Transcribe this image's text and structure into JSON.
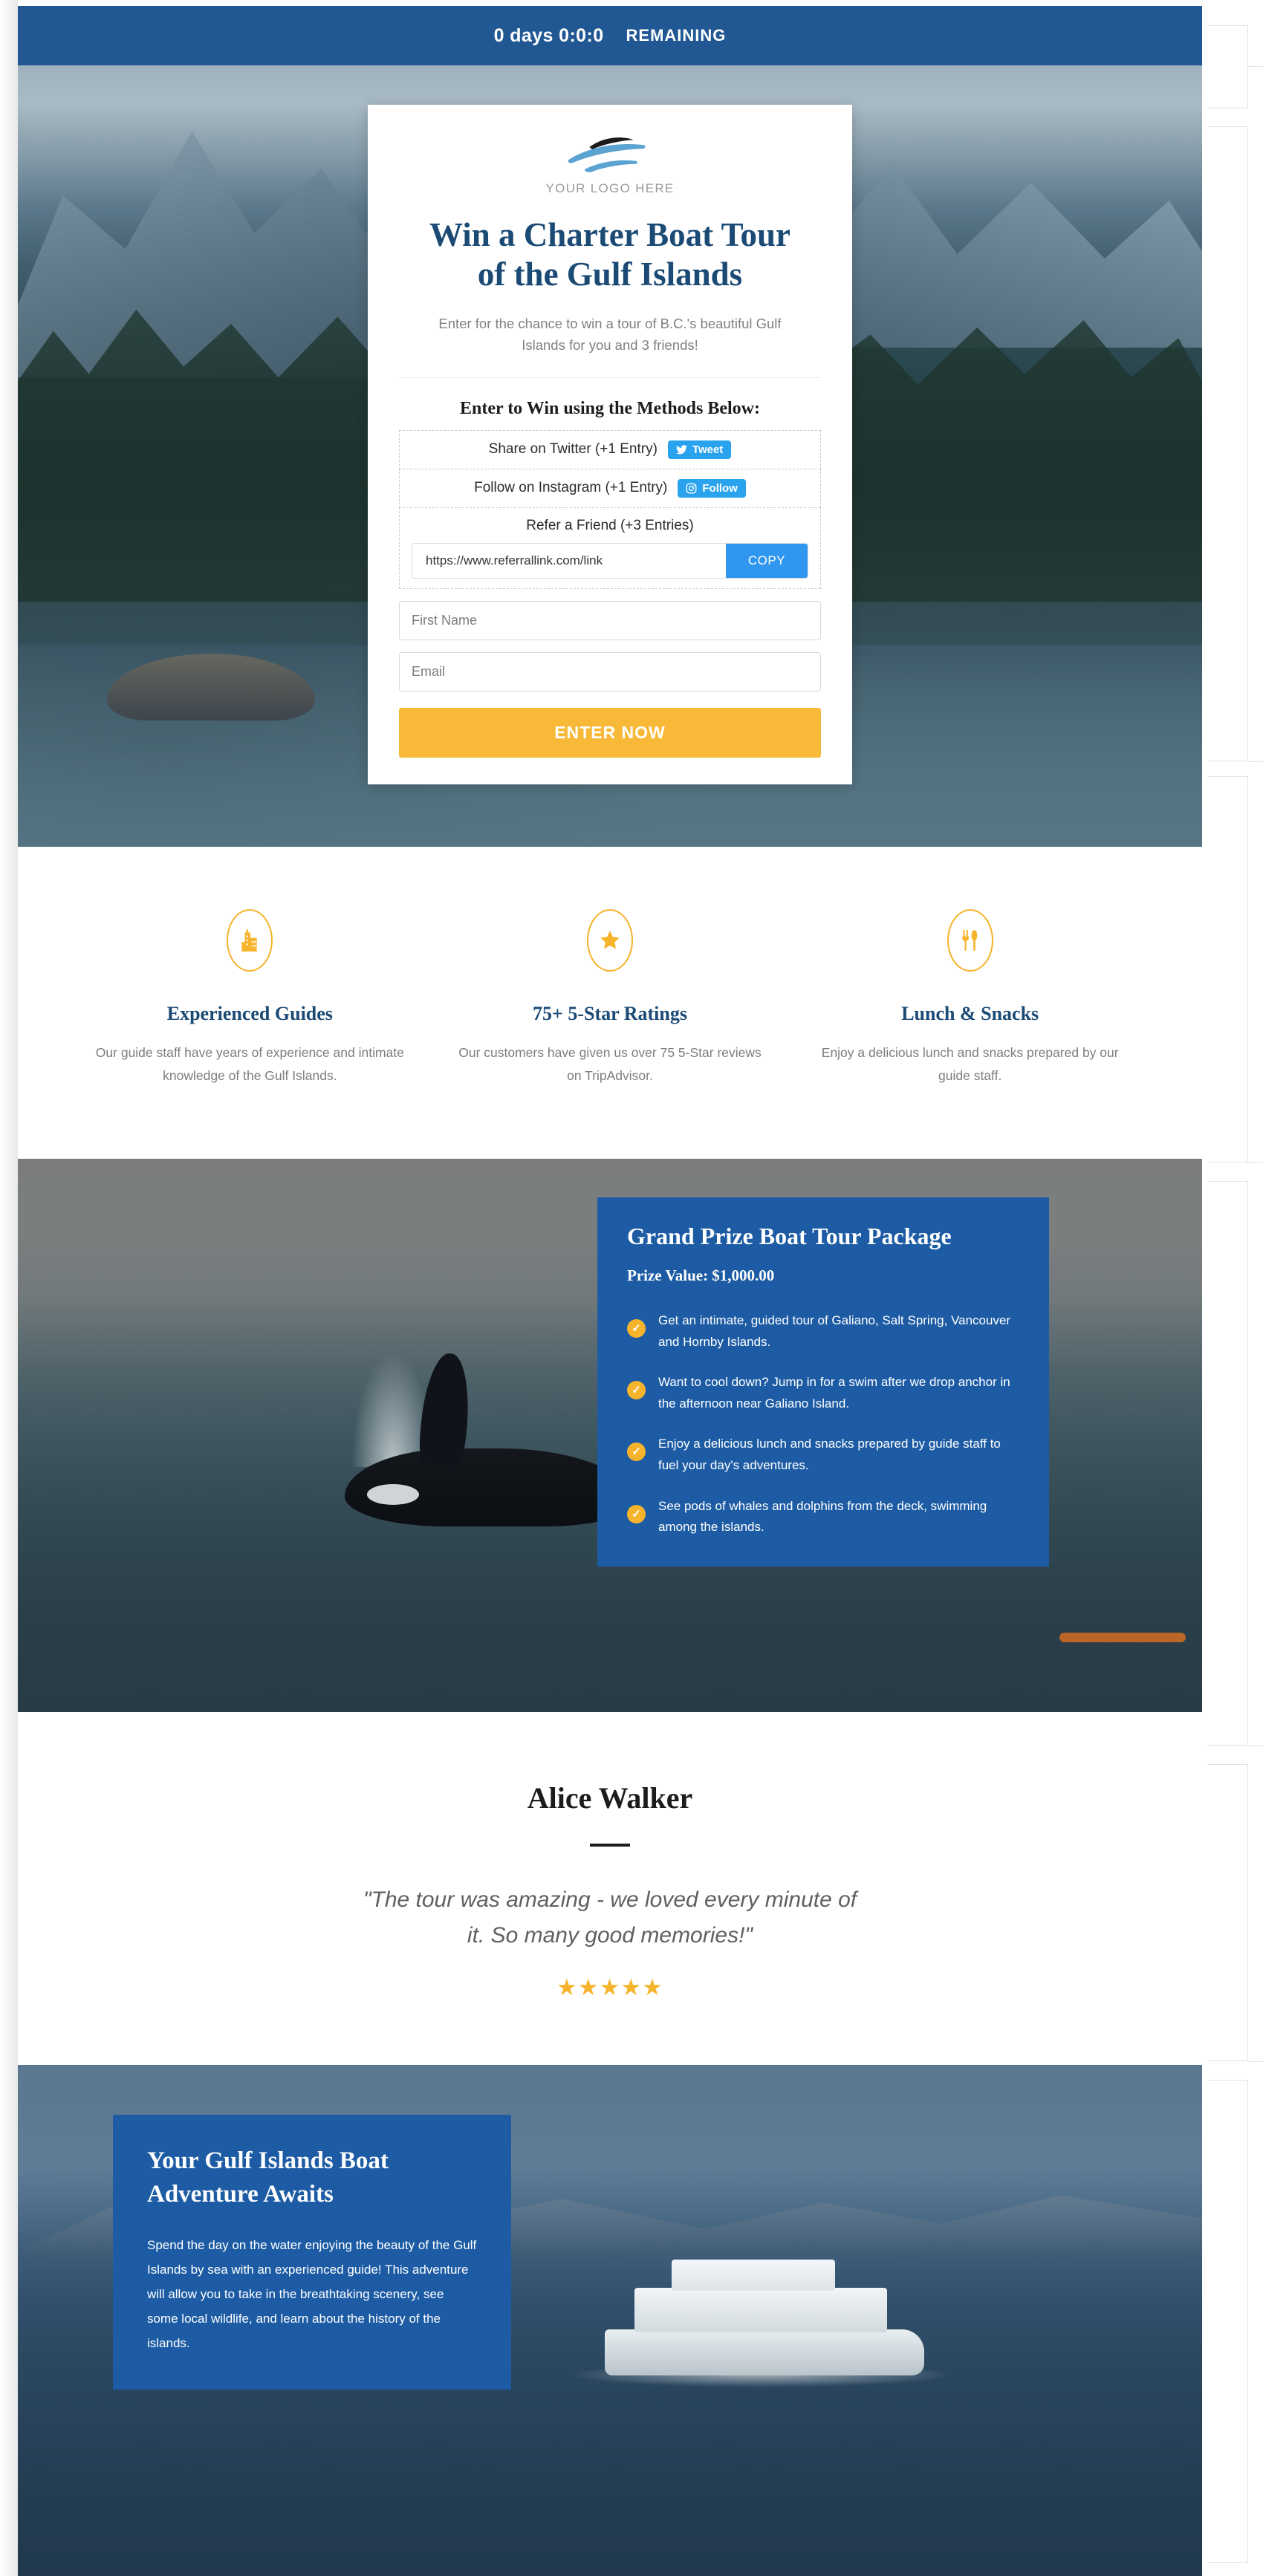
{
  "countdown": {
    "time": "0 days 0:0:0",
    "label": "REMAINING"
  },
  "card": {
    "logo_text": "YOUR LOGO HERE",
    "title_line1": "Win a Charter Boat Tour",
    "title_line2": "of the Gulf Islands",
    "subtitle": "Enter for the chance to win a tour of B.C.'s beautiful Gulf Islands for you and 3 friends!",
    "methods_title": "Enter to Win using the Methods Below:",
    "methods": [
      {
        "label": "Share on Twitter (+1 Entry)",
        "button": "Tweet",
        "icon": "twitter-bird-icon"
      },
      {
        "label": "Follow on Instagram (+1 Entry)",
        "button": "Follow",
        "icon": "instagram-camera-icon"
      }
    ],
    "refer": {
      "label": "Refer a Friend (+3 Entries)",
      "link_value": "https://www.referrallink.com/link",
      "copy_label": "COPY"
    },
    "first_name_placeholder": "First Name",
    "email_placeholder": "Email",
    "submit_label": "ENTER NOW"
  },
  "features": [
    {
      "icon": "building-icon",
      "title": "Experienced Guides",
      "desc": "Our guide staff have years of experience and intimate knowledge of the Gulf Islands."
    },
    {
      "icon": "star-icon",
      "title": "75+ 5-Star Ratings",
      "desc": "Our customers have given us over 75 5-Star reviews on TripAdvisor."
    },
    {
      "icon": "fork-knife-icon",
      "title": "Lunch & Snacks",
      "desc": "Enjoy a delicious lunch and snacks prepared by our guide staff."
    }
  ],
  "prize": {
    "title": "Grand Prize Boat Tour Package",
    "value": "Prize Value: $1,000.00",
    "items": [
      "Get an intimate, guided tour of Galiano, Salt Spring, Vancouver and Hornby Islands.",
      "Want to cool down? Jump in for a swim after we drop anchor in the afternoon near Galiano Island.",
      "Enjoy a delicious lunch and snacks prepared by guide staff to fuel your day's adventures.",
      "See pods of whales and dolphins from the deck, swimming among the islands."
    ]
  },
  "testimonial": {
    "name": "Alice Walker",
    "quote": "\"The tour was amazing - we loved every minute of it. So many good memories!\"",
    "stars": "★★★★★"
  },
  "cta": {
    "title_line1": "Your Gulf Islands Boat",
    "title_line2": "Adventure Awaits",
    "text": "Spend the day on the water enjoying the beauty of the Gulf Islands by sea with an experienced guide! This adventure will allow you to take in the breathtaking scenery, see some local wildlife, and learn about the history of the islands."
  },
  "colors": {
    "brand_blue": "#1d5ca4",
    "header_blue": "#215894",
    "accent_yellow": "#f9b938",
    "social_blue": "#2aa3ef",
    "title_navy": "#1b4a75"
  }
}
